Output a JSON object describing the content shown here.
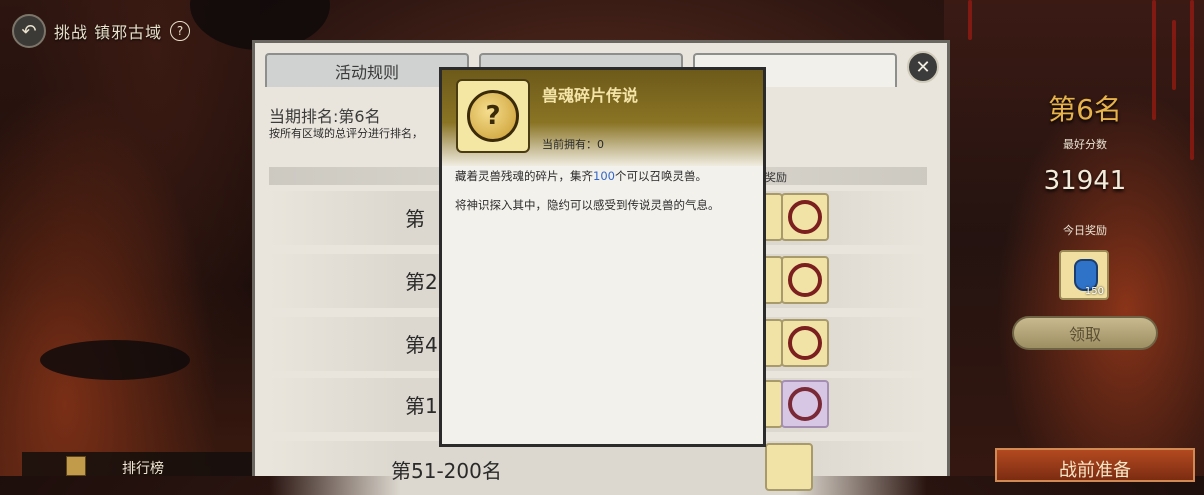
{
  "top_bar": {
    "title": "挑战 镇邪古域",
    "help": "?"
  },
  "panel": {
    "tabs": [
      {
        "label": "活动规则",
        "active": false
      },
      {
        "label": "",
        "active": false
      },
      {
        "label": "",
        "active": true
      }
    ],
    "current_rank_text": "当期排名:第6名",
    "rank_desc": "按所有区域的总评分进行排名，",
    "reward_header": "奖励",
    "rows": [
      {
        "label": "第"
      },
      {
        "label": "第2"
      },
      {
        "label": "第4"
      },
      {
        "label": "第11-"
      },
      {
        "label": "第51-200名"
      }
    ]
  },
  "tooltip": {
    "item_name": "兽魂碎片传说",
    "owned_label": "当前拥有：0",
    "desc_line1_prefix": "藏着灵兽残魂的碎片，集齐",
    "desc_line1_number": "100",
    "desc_line1_suffix": "个可以召唤灵兽。",
    "desc_line2": "将神识探入其中，隐约可以感受到传说灵兽的气息。"
  },
  "sidebar_right": {
    "rank": "第6名",
    "best_score_label": "最好分数",
    "best_score": "31941",
    "today_reward_label": "今日奖励",
    "today_reward_qty": "150",
    "claim_button": "领取",
    "prep_button": "战前准备"
  },
  "bottom_left": {
    "rankboard_label": "排行榜"
  },
  "colors": {
    "gold": "#e7b24a",
    "highlight_blue": "#3366cc",
    "panel_bg": "#e9e5dc"
  }
}
